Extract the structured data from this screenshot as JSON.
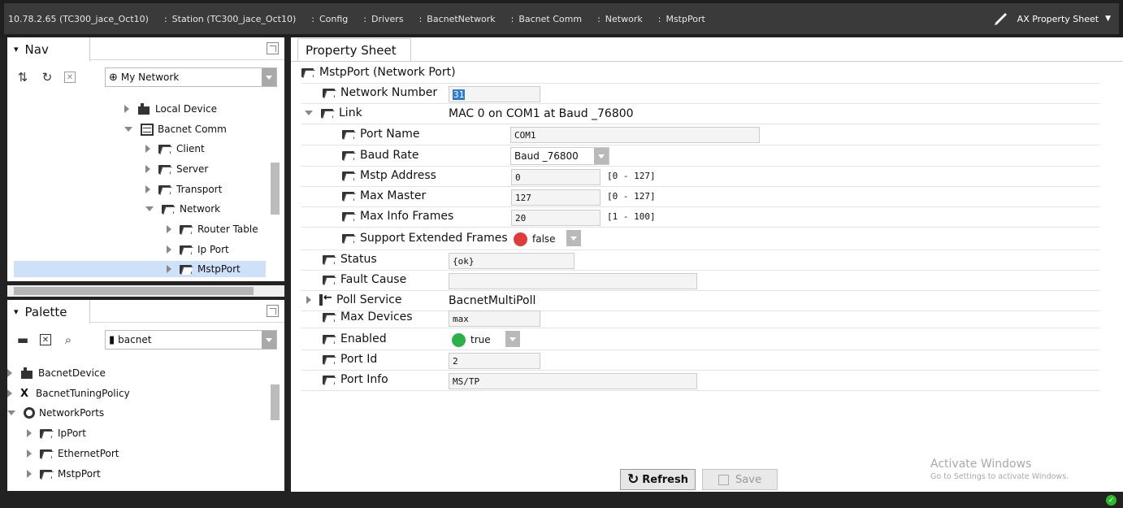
{
  "locator": {
    "crumbs": [
      "10.78.2.65 (TC300_jace_Oct10)",
      "Station (TC300_jace_Oct10)",
      "Config",
      "Drivers",
      "BacnetNetwork",
      "Bacnet Comm",
      "Network",
      "MstpPort"
    ],
    "view_label": "AX Property Sheet",
    "pen_icon": "pen-icon"
  },
  "nav": {
    "title": "Nav",
    "combo": "My Network",
    "tree": [
      {
        "label": "Local Device",
        "icon": "folder-icon"
      },
      {
        "label": "Bacnet Comm",
        "icon": "server-icon"
      },
      {
        "label": "Client",
        "icon": "folder-icon"
      },
      {
        "label": "Server",
        "icon": "folder-icon"
      },
      {
        "label": "Transport",
        "icon": "folder-icon"
      },
      {
        "label": "Network",
        "icon": "folder-icon"
      },
      {
        "label": "Router Table",
        "icon": "folder-icon"
      },
      {
        "label": "Ip Port",
        "icon": "folder-icon"
      },
      {
        "label": "MstpPort",
        "icon": "folder-icon",
        "selected": true
      }
    ]
  },
  "palette": {
    "title": "Palette",
    "combo": "bacnet",
    "tree": [
      {
        "label": "BacnetDevice"
      },
      {
        "label": "BacnetTuningPolicy"
      },
      {
        "label": "NetworkPorts"
      },
      {
        "label": "IpPort"
      },
      {
        "label": "EthernetPort"
      },
      {
        "label": "MstpPort"
      }
    ]
  },
  "sheet": {
    "tab": "Property Sheet",
    "root": "MstpPort  (Network Port)",
    "rows": {
      "network_number": {
        "label": "Network Number",
        "value": "31"
      },
      "link": {
        "label": "Link",
        "value": "MAC 0 on COM1 at Baud _76800"
      },
      "port_name": {
        "label": "Port Name",
        "value": "COM1"
      },
      "baud_rate": {
        "label": "Baud Rate",
        "value": "Baud _76800"
      },
      "mstp_address": {
        "label": "Mstp Address",
        "value": "0",
        "range": "[0 - 127]"
      },
      "max_master": {
        "label": "Max Master",
        "value": "127",
        "range": "[0 - 127]"
      },
      "max_info_frames": {
        "label": "Max Info Frames",
        "value": "20",
        "range": "[1 - 100]"
      },
      "support_ext": {
        "label": "Support Extended Frames",
        "value": "false",
        "color": "#e03c3c"
      },
      "status": {
        "label": "Status",
        "value": "{ok}"
      },
      "fault_cause": {
        "label": "Fault Cause",
        "value": ""
      },
      "poll_service": {
        "label": "Poll Service",
        "value": "BacnetMultiPoll"
      },
      "max_devices": {
        "label": "Max Devices",
        "value": "max"
      },
      "enabled": {
        "label": "Enabled",
        "value": "true",
        "color": "#2db04a"
      },
      "port_id": {
        "label": "Port Id",
        "value": "2"
      },
      "port_info": {
        "label": "Port Info",
        "value": "MS/TP"
      }
    }
  },
  "buttons": {
    "refresh": "Refresh",
    "save": "Save"
  },
  "watermark": {
    "line1": "Activate Windows",
    "line2": "Go to Settings to activate Windows."
  }
}
